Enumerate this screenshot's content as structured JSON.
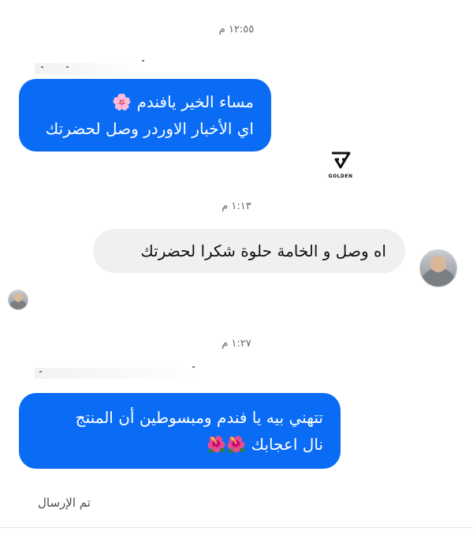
{
  "conversation": {
    "timestamps": [
      "١٢:٥٥ م",
      "١:١٣ م",
      "١:٢٧ م"
    ],
    "messages": [
      {
        "direction": "sent",
        "lines": [
          "مساء الخير يافندم 🌸",
          "اي الأخبار الاوردر وصل لحضرتك"
        ]
      },
      {
        "direction": "received",
        "lines": [
          "اه وصل و الخامة حلوة شكرا لحضرتك"
        ]
      },
      {
        "direction": "sent",
        "lines": [
          "تتهني بيه يا فندم ومبسوطين أن المنتج",
          "نال اعجابك 🌺🌺"
        ]
      }
    ],
    "status": "تم الإرسال"
  },
  "watermark": {
    "text": "GOLDEN",
    "icon": "golden-g-logo"
  },
  "colors": {
    "sent_bubble": "#0a6cf5",
    "received_bubble": "#f0f0f3",
    "timestamp": "#65676b"
  }
}
